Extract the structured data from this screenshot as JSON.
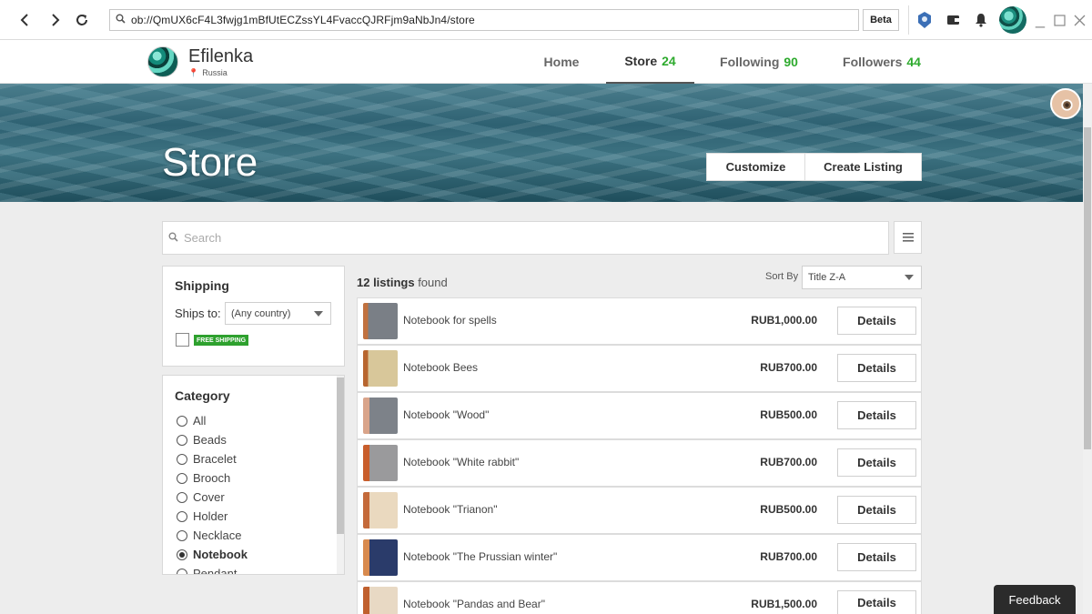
{
  "browser": {
    "url": "ob://QmUX6cF4L3fwjg1mBfUtECZssYL4FvaccQJRFjm9aNbJn4/store",
    "beta_label": "Beta"
  },
  "profile": {
    "name": "Efilenka",
    "location": "Russia",
    "tabs": [
      {
        "label": "Home",
        "count": ""
      },
      {
        "label": "Store",
        "count": "24"
      },
      {
        "label": "Following",
        "count": "90"
      },
      {
        "label": "Followers",
        "count": "44"
      }
    ]
  },
  "banner": {
    "title": "Store",
    "customize_label": "Customize",
    "create_listing_label": "Create Listing"
  },
  "search": {
    "placeholder": "Search"
  },
  "shipping": {
    "title": "Shipping",
    "ships_to_label": "Ships to:",
    "ships_to_value": "(Any country)",
    "free_shipping_label": "FREE SHIPPING"
  },
  "category": {
    "title": "Category",
    "items": [
      "All",
      "Beads",
      "Bracelet",
      "Brooch",
      "Cover",
      "Holder",
      "Necklace",
      "Notebook",
      "Pendant"
    ],
    "selected": "Notebook"
  },
  "listings": {
    "count": "12 listings",
    "found_suffix": " found",
    "sort_label": "Sort By",
    "sort_value": "Title Z-A",
    "details_label": "Details",
    "items": [
      {
        "name": "Notebook for spells",
        "price": "RUB1,000.00"
      },
      {
        "name": "Notebook Bees",
        "price": "RUB700.00"
      },
      {
        "name": "Notebook \"Wood\"",
        "price": "RUB500.00"
      },
      {
        "name": "Notebook \"White rabbit\"",
        "price": "RUB700.00"
      },
      {
        "name": "Notebook \"Trianon\"",
        "price": "RUB500.00"
      },
      {
        "name": "Notebook \"The Prussian winter\"",
        "price": "RUB700.00"
      },
      {
        "name": "Notebook \"Pandas and Bear\"",
        "price": "RUB1,500.00"
      }
    ]
  },
  "feedback_label": "Feedback",
  "colors": {
    "count_green": "#2eaa2e",
    "free_shipping_green": "#2ea12e"
  }
}
